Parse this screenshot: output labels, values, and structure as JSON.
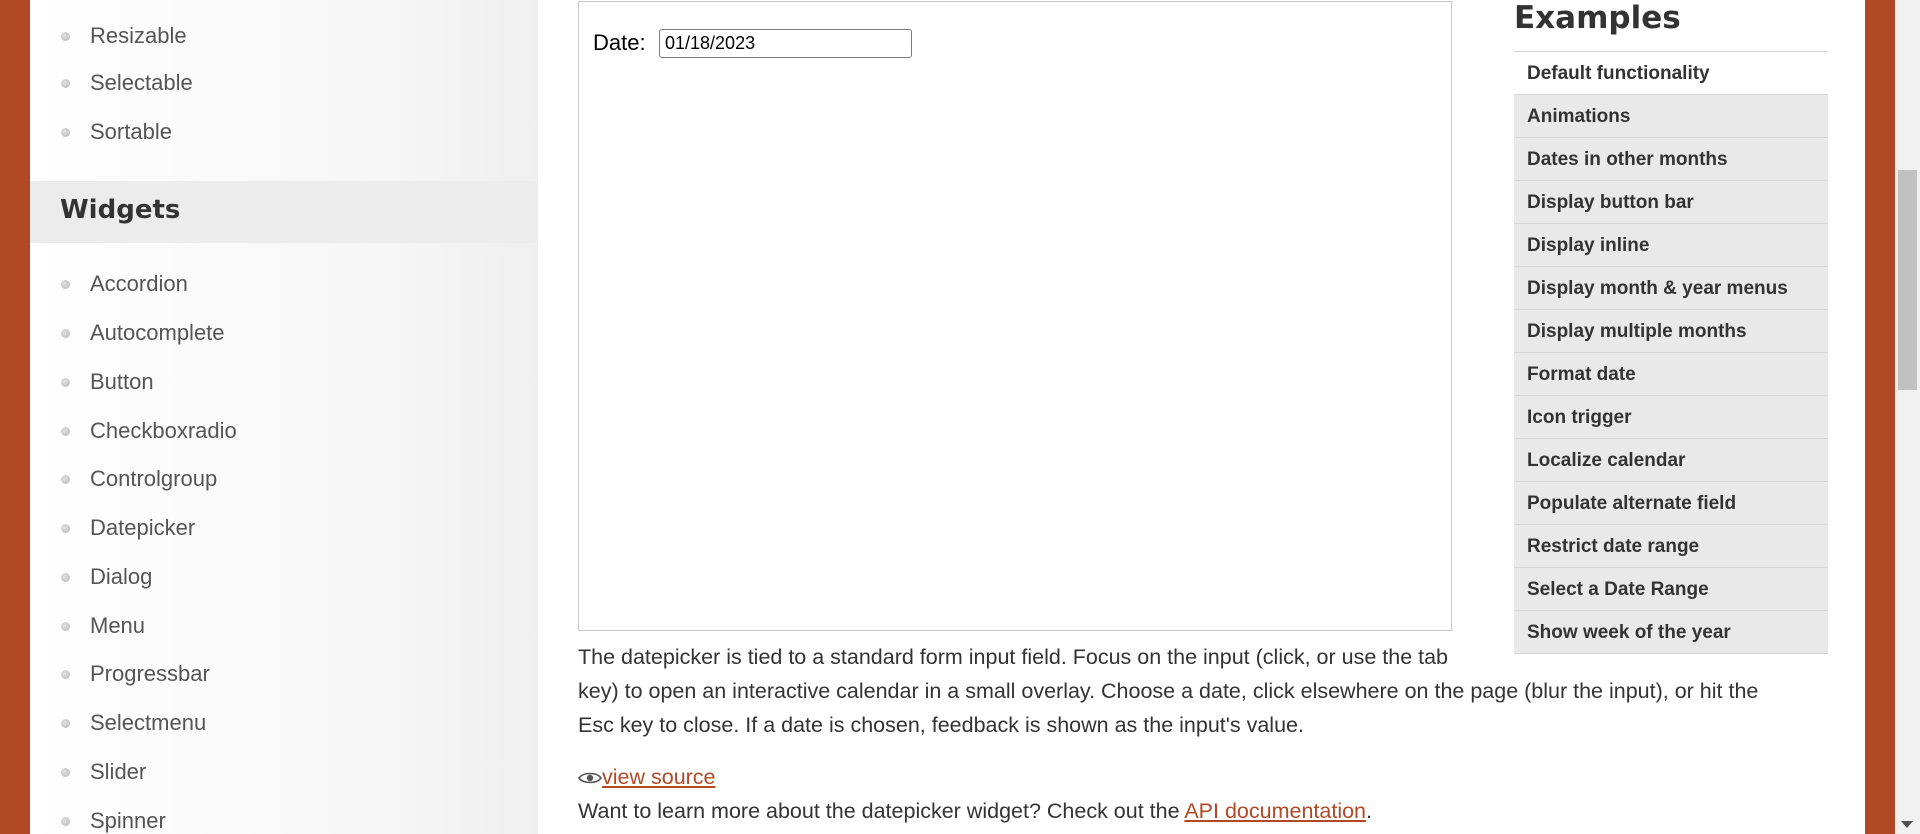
{
  "sidebar": {
    "interactions": [
      {
        "label": "Resizable"
      },
      {
        "label": "Selectable"
      },
      {
        "label": "Sortable"
      }
    ],
    "widgets_heading": "Widgets",
    "widgets": [
      {
        "label": "Accordion"
      },
      {
        "label": "Autocomplete"
      },
      {
        "label": "Button"
      },
      {
        "label": "Checkboxradio"
      },
      {
        "label": "Controlgroup"
      },
      {
        "label": "Datepicker"
      },
      {
        "label": "Dialog"
      },
      {
        "label": "Menu"
      },
      {
        "label": "Progressbar"
      },
      {
        "label": "Selectmenu"
      },
      {
        "label": "Slider"
      },
      {
        "label": "Spinner"
      }
    ]
  },
  "demo": {
    "date_label": "Date:",
    "date_value": "01/18/2023"
  },
  "description": {
    "line1": "The datepicker is tied to a standard form input field. Focus on the input (click, or use the tab",
    "line2": "key) to open an interactive calendar in a small overlay. Choose a date, click elsewhere on the page (blur the input), or hit the",
    "line3": "Esc key to close. If a date is chosen, feedback is shown as the input's value."
  },
  "view_source": {
    "label": "view source",
    "icon": "eye-icon"
  },
  "learn_more": {
    "prefix": "Want to learn more about the datepicker widget? Check out the ",
    "link": "API documentation",
    "suffix": "."
  },
  "examples": {
    "heading": "Examples",
    "items": [
      {
        "label": "Default functionality"
      },
      {
        "label": "Animations"
      },
      {
        "label": "Dates in other months"
      },
      {
        "label": "Display button bar"
      },
      {
        "label": "Display inline"
      },
      {
        "label": "Display month & year menus"
      },
      {
        "label": "Display multiple months"
      },
      {
        "label": "Format date"
      },
      {
        "label": "Icon trigger"
      },
      {
        "label": "Localize calendar"
      },
      {
        "label": "Populate alternate field"
      },
      {
        "label": "Restrict date range"
      },
      {
        "label": "Select a Date Range"
      },
      {
        "label": "Show week of the year"
      }
    ]
  },
  "colors": {
    "frame_background": "#b24926",
    "link": "#b24926",
    "text": "#333333"
  }
}
